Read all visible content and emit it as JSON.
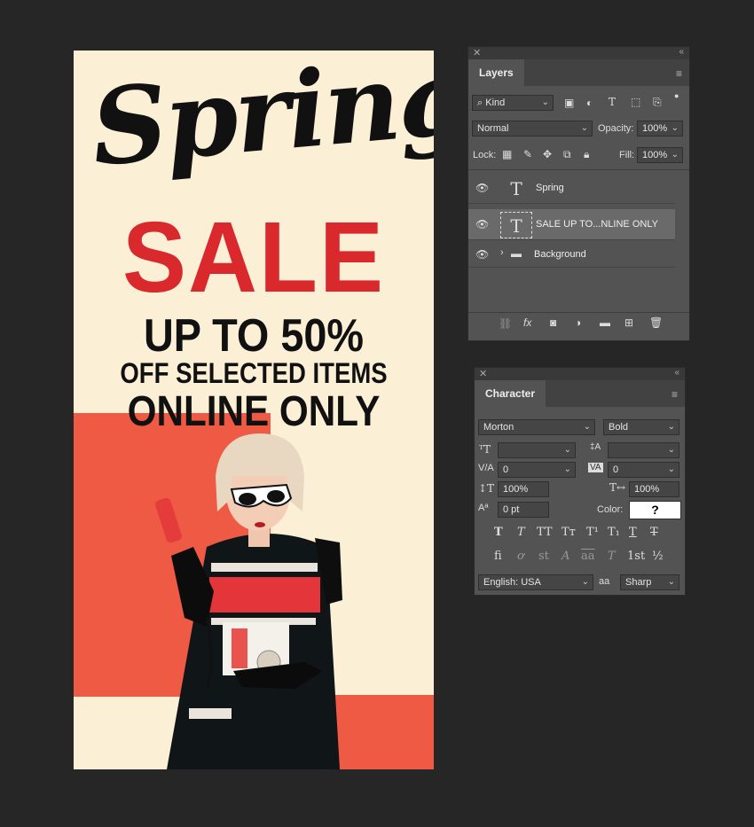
{
  "poster": {
    "script_title": "Spring",
    "sale": "SALE",
    "line1": "UP TO 50%",
    "line2": "OFF SELECTED ITEMS",
    "line3": "ONLINE ONLY",
    "colors": {
      "background": "#fbefd6",
      "accent_red": "#d9292c",
      "block_red": "#ef5a45"
    }
  },
  "layers_panel": {
    "tab": "Layers",
    "filter_kind": "Kind",
    "blend_mode": "Normal",
    "opacity_label": "Opacity:",
    "opacity_value": "100%",
    "lock_label": "Lock:",
    "fill_label": "Fill:",
    "fill_value": "100%",
    "layers": [
      {
        "name": "Spring",
        "type": "text",
        "selected": false
      },
      {
        "name": "SALE UP TO...NLINE ONLY",
        "type": "text",
        "selected": true
      },
      {
        "name": "Background",
        "type": "group",
        "selected": false
      }
    ],
    "footer_icons": [
      "link-icon",
      "fx-icon",
      "mask-icon",
      "adjustment-icon",
      "folder-icon",
      "new-layer-icon",
      "trash-icon"
    ]
  },
  "character_panel": {
    "tab": "Character",
    "font_family": "Morton",
    "font_style": "Bold",
    "font_size": "",
    "leading": "",
    "kerning": "0",
    "tracking": "0",
    "vertical_scale": "100%",
    "horizontal_scale": "100%",
    "baseline_shift": "0 pt",
    "color_label": "Color:",
    "color_value": "?",
    "language": "English: USA",
    "antialias_label": "aa",
    "antialias": "Sharp",
    "style_buttons": [
      "T",
      "T",
      "TT",
      "Tт",
      "T¹",
      "T₁",
      "T",
      "T"
    ],
    "opentype_buttons": [
      "fi",
      "ơ",
      "st",
      "A",
      "aa",
      "T",
      "1st",
      "½"
    ]
  }
}
